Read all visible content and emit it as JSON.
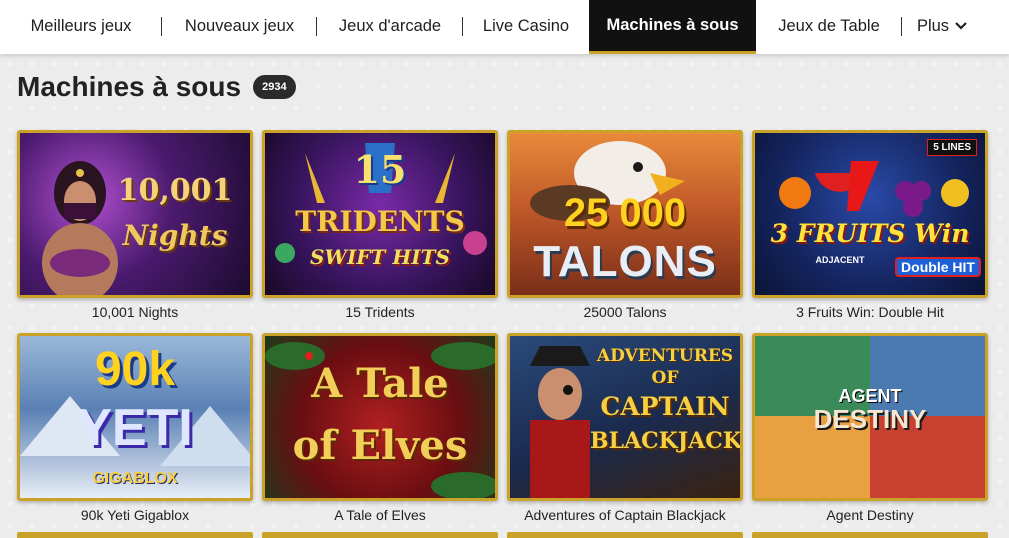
{
  "nav": {
    "items": [
      {
        "label": "Meilleurs jeux"
      },
      {
        "label": "Nouveaux jeux"
      },
      {
        "label": "Jeux d'arcade"
      },
      {
        "label": "Live Casino"
      },
      {
        "label": "Machines à sous"
      },
      {
        "label": "Jeux de Table"
      },
      {
        "label": "Plus"
      }
    ],
    "active_index": 4,
    "more_icon": "chevron-down-icon"
  },
  "section": {
    "title": "Machines à sous",
    "count": "2934"
  },
  "games": [
    {
      "name": "10,001 Nights",
      "art_lines": [
        "10,001",
        "Nights"
      ]
    },
    {
      "name": "15 Tridents",
      "art_lines": [
        "15",
        "TRIDENTS",
        "SWIFT HITS"
      ]
    },
    {
      "name": "25000 Talons",
      "art_lines": [
        "25 000",
        "TALONS"
      ]
    },
    {
      "name": "3 Fruits Win: Double Hit",
      "art_lines": [
        "5 LINES",
        "3 FRUITS Win",
        "ADJACENT",
        "Double HIT"
      ]
    },
    {
      "name": "90k Yeti Gigablox",
      "art_lines": [
        "90k",
        "YETI",
        "GIGABLOX"
      ]
    },
    {
      "name": "A Tale of Elves",
      "art_lines": [
        "A Tale",
        "of Elves"
      ]
    },
    {
      "name": "Adventures of Captain Blackjack",
      "art_lines": [
        "ADVENTURES",
        "OF",
        "CAPTAIN",
        "BLACKJACK"
      ]
    },
    {
      "name": "Agent Destiny",
      "art_lines": [
        "AGENT",
        "DESTINY"
      ]
    }
  ],
  "colors": {
    "gold_border": "#c9a227",
    "nav_active_bg": "#111111"
  }
}
